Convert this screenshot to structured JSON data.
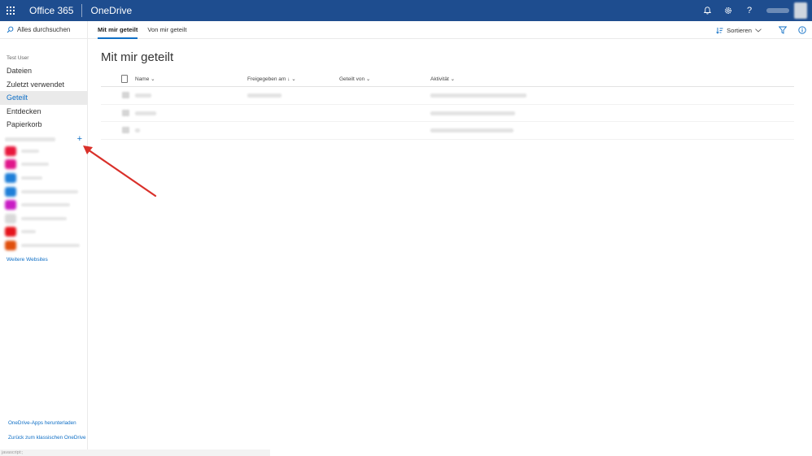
{
  "suitebar": {
    "app_launcher_icon": "waffle-icon",
    "brand": "Office 365",
    "app": "OneDrive",
    "icons": [
      "bell-icon",
      "gear-icon",
      "help-icon"
    ],
    "help_glyph": "?",
    "background": "#1e4d8f"
  },
  "leftnav": {
    "search_placeholder": "Alles durchsuchen",
    "user_name": "Test User",
    "items": [
      {
        "label": "Dateien",
        "active": false
      },
      {
        "label": "Zuletzt verwendet",
        "active": false
      },
      {
        "label": "Geteilt",
        "active": true
      },
      {
        "label": "Entdecken",
        "active": false
      },
      {
        "label": "Papierkorb",
        "active": false
      }
    ],
    "add_site_glyph": "+",
    "site_colors": [
      "#e8173c",
      "#e0168a",
      "#1f7fd8",
      "#1f7fd8",
      "#c81cc4",
      "#d9d9d9",
      "#e5141b",
      "#e04f0c"
    ],
    "more_sites": "Weitere Websites",
    "bottom_links": [
      "OneDrive-Apps herunterladen",
      "Zurück zum klassischen OneDrive"
    ],
    "status_text": "javascript:;"
  },
  "cmdbar": {
    "tabs": [
      {
        "label": "Mit mir geteilt",
        "active": true
      },
      {
        "label": "Von mir geteilt",
        "active": false
      }
    ],
    "sort_label": "Sortieren",
    "sort_icon": "sort-icon",
    "filter_icon": "filter-icon",
    "info_icon": "info-icon",
    "accent": "#0f6fc6"
  },
  "main": {
    "title": "Mit mir geteilt",
    "columns": [
      "Name",
      "Freigegeben am",
      "Geteilt von",
      "Aktivität"
    ],
    "sort_indicator": "↓"
  }
}
